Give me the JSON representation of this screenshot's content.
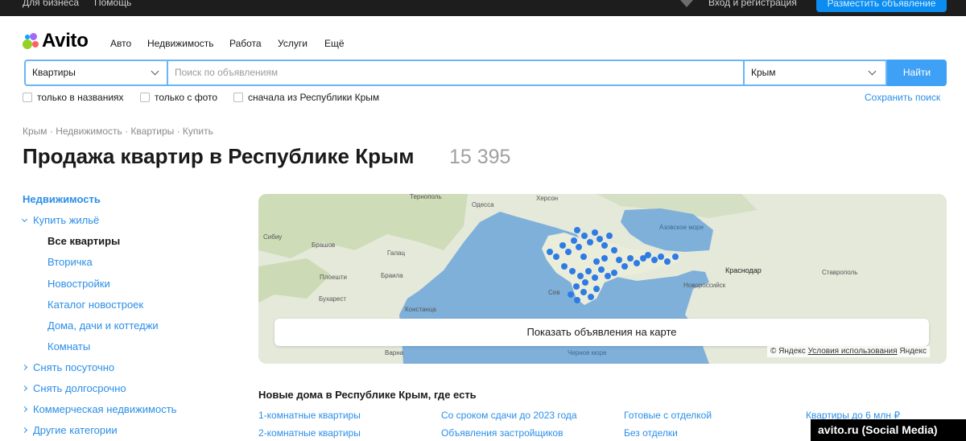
{
  "topbar": {
    "business": "Для бизнеса",
    "help": "Помощь",
    "login": "Вход и регистрация",
    "post_ad": "Разместить объявление"
  },
  "logo": {
    "text": "Avito"
  },
  "nav": [
    "Авто",
    "Недвижимость",
    "Работа",
    "Услуги",
    "Ещё"
  ],
  "search": {
    "category": "Квартиры",
    "placeholder": "Поиск по объявлениям",
    "region": "Крым",
    "button": "Найти",
    "checks": [
      "только в названиях",
      "только с фото",
      "сначала из Республики Крым"
    ],
    "save": "Сохранить поиск"
  },
  "breadcrumb": "Крым · Недвижимость · Квартиры · Купить",
  "page_title": "Продажа квартир в Республике Крым",
  "result_count": "15 395",
  "sidebar": {
    "root": "Недвижимость",
    "buy": "Купить жильё",
    "buy_items": [
      "Все квартиры",
      "Вторичка",
      "Новостройки",
      "Каталог новостроек",
      "Дома, дачи и коттеджи",
      "Комнаты"
    ],
    "others": [
      "Снять посуточно",
      "Снять долгосрочно",
      "Коммерческая недвижимость",
      "Другие категории"
    ]
  },
  "map": {
    "labels": [
      "Тернополь",
      "Одесса",
      "Херсон",
      "Сибиу",
      "Брашов",
      "Галац",
      "Браила",
      "Плоешти",
      "Бухарест",
      "Констанца",
      "Варна",
      "Азовское море",
      "Краснодар",
      "Ставрополь",
      "Новороссийск",
      "Сев"
    ],
    "sea_label": "Черное море",
    "show_button": "Показать объявления на карте",
    "attribution": "© Яндекс",
    "terms": "Условия использования",
    "brand": "Яндекс",
    "sea_color": "#7fb0da",
    "land_color": "#dfe7d3",
    "marker_color": "#2f7be6"
  },
  "new_houses": {
    "title": "Новые дома в Республике Крым, где есть",
    "links": [
      [
        "1-комнатные квартиры",
        "2-комнатные квартиры"
      ],
      [
        "Со сроком сдачи до 2023 года",
        "Объявления застройщиков"
      ],
      [
        "Готовые с отделкой",
        "Без отделки"
      ],
      [
        "Квартиры до 6 млн ₽"
      ]
    ]
  },
  "watermark": "avito.ru (Social Media)"
}
